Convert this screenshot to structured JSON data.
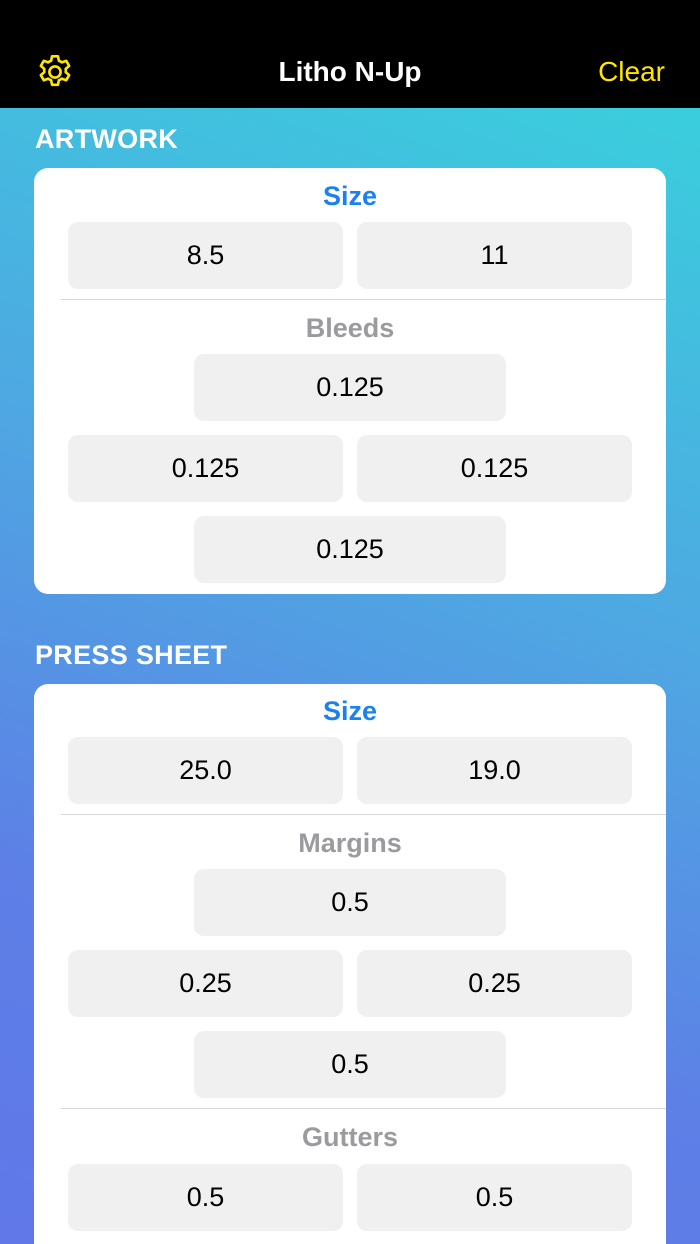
{
  "nav": {
    "title": "Litho N-Up",
    "clear_label": "Clear",
    "settings_icon": "gear-icon",
    "accent_color": "#ffe600"
  },
  "artwork": {
    "header": "ARTWORK",
    "size_label": "Size",
    "size_width": "8.5",
    "size_height": "11",
    "bleeds_label": "Bleeds",
    "bleed_top": "0.125",
    "bleed_left": "0.125",
    "bleed_right": "0.125",
    "bleed_bottom": "0.125"
  },
  "press_sheet": {
    "header": "PRESS SHEET",
    "size_label": "Size",
    "size_width": "25.0",
    "size_height": "19.0",
    "margins_label": "Margins",
    "margin_top": "0.5",
    "margin_left": "0.25",
    "margin_right": "0.25",
    "margin_bottom": "0.5",
    "gutters_label": "Gutters",
    "gutter_horizontal": "0.5",
    "gutter_vertical": "0.5"
  },
  "colors": {
    "label_blue": "#1a82f0",
    "label_gray": "#9a9a9f",
    "field_bg": "#f0f0f0"
  }
}
